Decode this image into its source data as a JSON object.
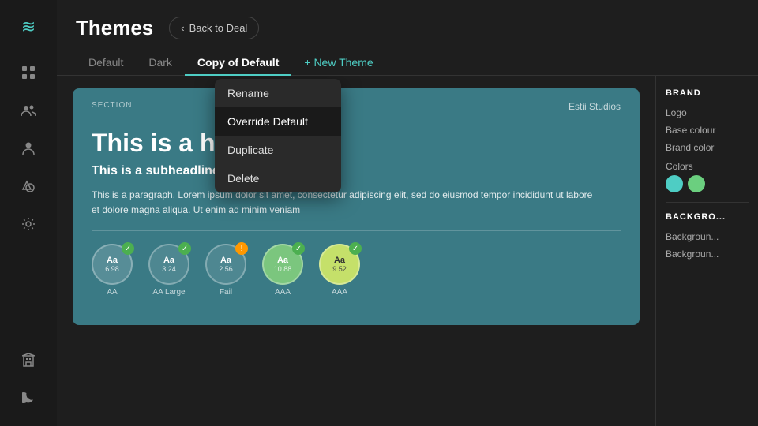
{
  "sidebar": {
    "logo_icon": "≋",
    "icons": [
      {
        "name": "grid-icon",
        "symbol": "⊞"
      },
      {
        "name": "users-icon",
        "symbol": "👥"
      },
      {
        "name": "person-icon",
        "symbol": "👤"
      },
      {
        "name": "shapes-icon",
        "symbol": "🎲"
      },
      {
        "name": "settings-icon",
        "symbol": "⚙"
      }
    ],
    "bottom_icons": [
      {
        "name": "building-icon",
        "symbol": "🏢"
      },
      {
        "name": "moon-icon",
        "symbol": "🌙"
      }
    ]
  },
  "header": {
    "title": "Themes",
    "back_button": "Back to Deal",
    "back_icon": "‹"
  },
  "tabs": [
    {
      "label": "Default",
      "active": false
    },
    {
      "label": "Dark",
      "active": false
    },
    {
      "label": "Copy of Default",
      "active": true
    }
  ],
  "new_theme_label": "+ New Theme",
  "context_menu": {
    "items": [
      {
        "label": "Rename",
        "highlighted": false
      },
      {
        "label": "Override Default",
        "highlighted": true
      },
      {
        "label": "Duplicate",
        "highlighted": false
      },
      {
        "label": "Delete",
        "highlighted": false
      }
    ]
  },
  "preview": {
    "section_label": "SECTION",
    "studio_label": "Estii Studios",
    "headline": "This is a headline",
    "subheadline": "This is a subheadline",
    "paragraph": "This is a paragraph. Lorem ipsum dolor sit amet, consectetur adipiscing elit, sed do eiusmod tempor incididunt ut labore et dolore magna aliqua. Ut enim ad minim veniam"
  },
  "contrast": {
    "items": [
      {
        "label": "AA",
        "aa": "Aa",
        "ratio": "6.98",
        "badge": "✓",
        "badge_type": "green",
        "circle_class": "circle-light"
      },
      {
        "label": "AA Large",
        "aa": "Aa",
        "ratio": "3.24",
        "badge": "✓",
        "badge_type": "green",
        "circle_class": "circle-medium"
      },
      {
        "label": "Fail",
        "aa": "Aa",
        "ratio": "2.56",
        "badge": "!",
        "badge_type": "orange",
        "circle_class": "circle-medium"
      },
      {
        "label": "AAA",
        "aa": "Aa",
        "ratio": "10.88",
        "badge": "✓",
        "badge_type": "green",
        "circle_class": "circle-green"
      },
      {
        "label": "AAA",
        "aa": "Aa",
        "ratio": "9.52",
        "badge": "✓",
        "badge_type": "green",
        "circle_class": "circle-lime"
      }
    ]
  },
  "right_panel": {
    "brand_title": "BRAND",
    "brand_items": [
      "Logo",
      "Base colour",
      "Brand color"
    ],
    "colors_title": "Colors",
    "color_dots": [
      "#4ecdc4",
      "#6bcf7f"
    ],
    "background_title": "BACKGRO...",
    "background_items": [
      "Backgroun...",
      "Backgroun..."
    ]
  }
}
